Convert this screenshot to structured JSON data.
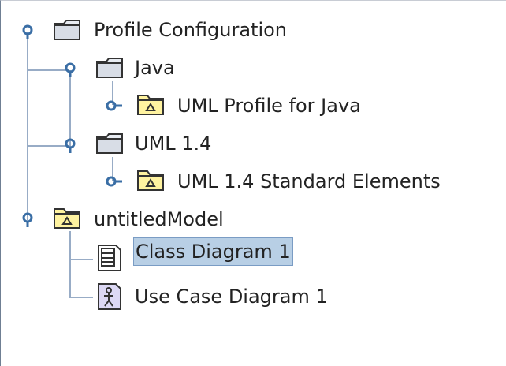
{
  "tree": {
    "nodes": [
      {
        "label": "Profile Configuration",
        "icon": "folder-icon",
        "expanded": true
      },
      {
        "label": "Java",
        "icon": "folder-icon",
        "expanded": true
      },
      {
        "label": "UML Profile for Java",
        "icon": "model-package-icon",
        "expanded": false
      },
      {
        "label": "UML 1.4",
        "icon": "folder-icon",
        "expanded": true
      },
      {
        "label": "UML 1.4 Standard Elements",
        "icon": "model-package-icon",
        "expanded": false
      },
      {
        "label": "untitledModel",
        "icon": "model-package-icon",
        "expanded": true
      },
      {
        "label": "Class Diagram 1",
        "icon": "class-diagram-icon",
        "selected": true
      },
      {
        "label": "Use Case Diagram 1",
        "icon": "use-case-diagram-icon",
        "selected": false
      }
    ]
  },
  "colors": {
    "connector_line": "#98acc6",
    "handle": "#3a6ea5",
    "selection_background": "#b8cfe5",
    "package_fill": "#fff3a0"
  }
}
